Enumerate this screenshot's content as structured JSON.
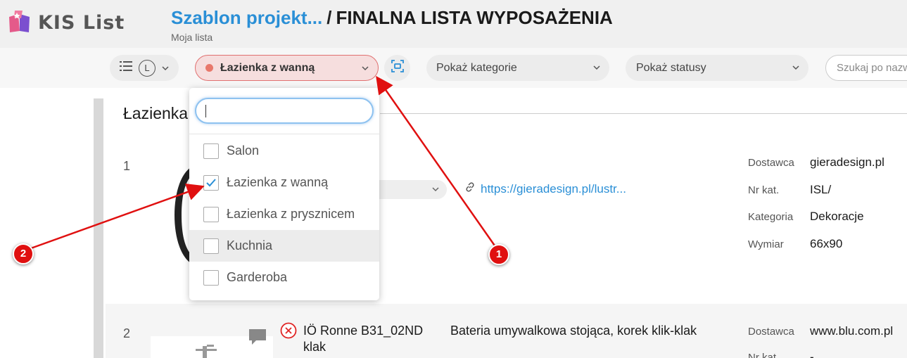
{
  "header": {
    "logo_text": "KIS List",
    "breadcrumb_link": "Szablon projekt...",
    "breadcrumb_separator": "/",
    "page_title": "FINALNA LISTA WYPOSAŻENIA",
    "subtitle": "Moja lista"
  },
  "toolbar": {
    "view_icon": "list-icon",
    "view_letter": "L",
    "room_selected": "Łazienka z wanną",
    "room_dot_color": "#e8786b",
    "scan_icon": "scan-icon",
    "category_filter": "Pokaż kategorie",
    "status_filter": "Pokaż statusy",
    "search_placeholder": "Szukaj po nazwie"
  },
  "dropdown": {
    "search_value": "",
    "options": [
      {
        "label": "Salon",
        "checked": false
      },
      {
        "label": "Łazienka z wanną",
        "checked": true
      },
      {
        "label": "Łazienka z prysznicem",
        "checked": false
      },
      {
        "label": "Kuchnia",
        "checked": false
      },
      {
        "label": "Garderoba",
        "checked": false
      }
    ]
  },
  "section": {
    "title": "Łazienka z wanną"
  },
  "items": [
    {
      "number": "1",
      "link": "https://gieradesign.pl/lustr...",
      "props": [
        {
          "label": "Dostawca",
          "value": "gieradesign.pl"
        },
        {
          "label": "Nr kat.",
          "value": "ISL/"
        },
        {
          "label": "Kategoria",
          "value": "Dekoracje"
        },
        {
          "label": "Wymiar",
          "value": "66x90"
        }
      ]
    },
    {
      "number": "2",
      "name": "IÖ Ronne B31_02ND klak",
      "description": "Bateria umywalkowa stojąca, korek klik-klak",
      "props": [
        {
          "label": "Dostawca",
          "value": "www.blu.com.pl"
        },
        {
          "label": "Nr kat.",
          "value": "-"
        }
      ]
    }
  ],
  "annotations": [
    {
      "label": "1"
    },
    {
      "label": "2"
    }
  ],
  "colors": {
    "accent_blue": "#2a8fd6",
    "annotation_red": "#e01010",
    "selected_border": "#e07070"
  }
}
